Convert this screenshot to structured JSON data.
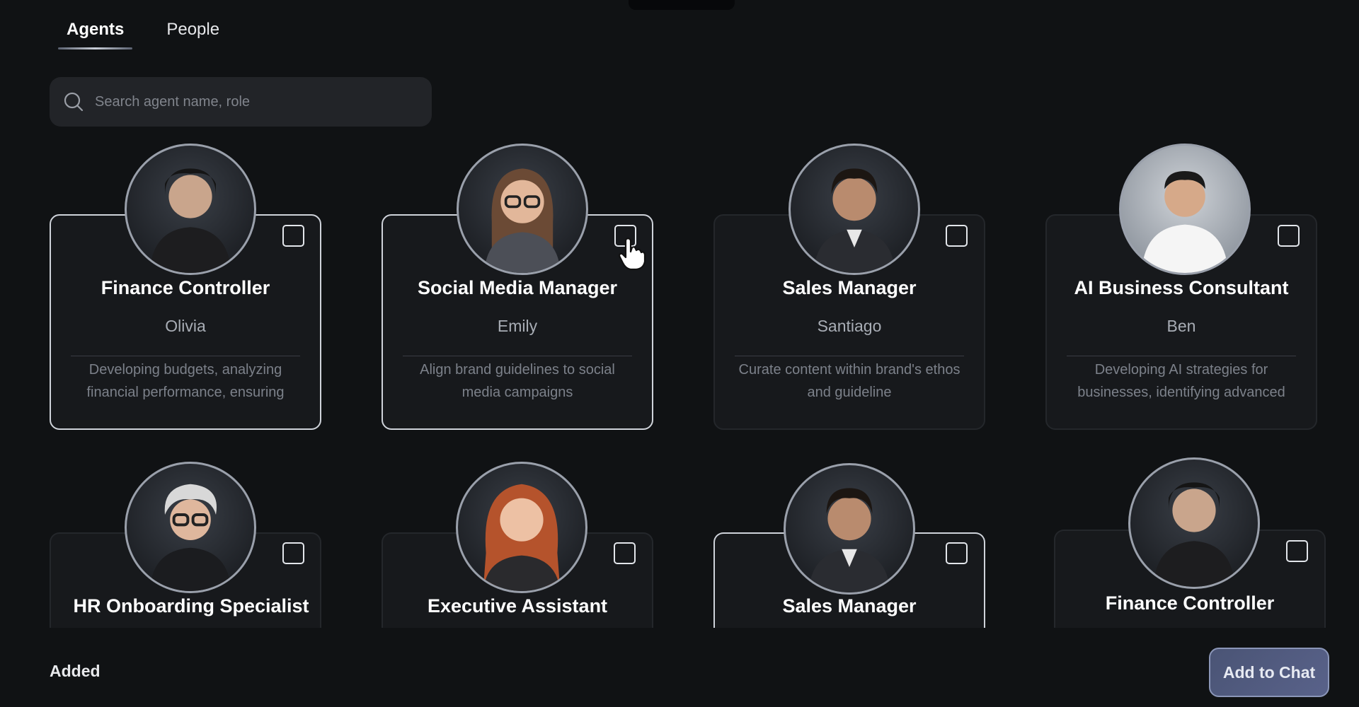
{
  "tabs": [
    {
      "label": "Agents",
      "active": true
    },
    {
      "label": "People",
      "active": false
    }
  ],
  "search": {
    "placeholder": "Search agent name, role",
    "icon": "search-icon"
  },
  "agents": [
    {
      "role": "Finance Controller",
      "name": "Olivia",
      "description": "Developing budgets, analyzing financial performance, ensuring",
      "checked": false
    },
    {
      "role": "Social Media Manager",
      "name": "Emily",
      "description": "Align brand guidelines to social media campaigns",
      "checked": false
    },
    {
      "role": "Sales Manager",
      "name": "Santiago",
      "description": "Curate content within brand's ethos and guideline",
      "checked": false
    },
    {
      "role": "AI Business Consultant",
      "name": "Ben",
      "description": "Developing AI strategies for businesses, identifying advanced",
      "checked": false
    },
    {
      "role": "HR Onboarding Specialist",
      "checked": false
    },
    {
      "role": "Executive Assistant",
      "checked": false
    },
    {
      "role": "Sales Manager",
      "checked": false
    },
    {
      "role": "Finance Controller",
      "checked": false
    }
  ],
  "footer": {
    "added_label": "Added",
    "add_button_label": "Add to Chat"
  },
  "colors": {
    "background": "#101214",
    "card": "#17191c",
    "accent_button": "#4a5475"
  }
}
